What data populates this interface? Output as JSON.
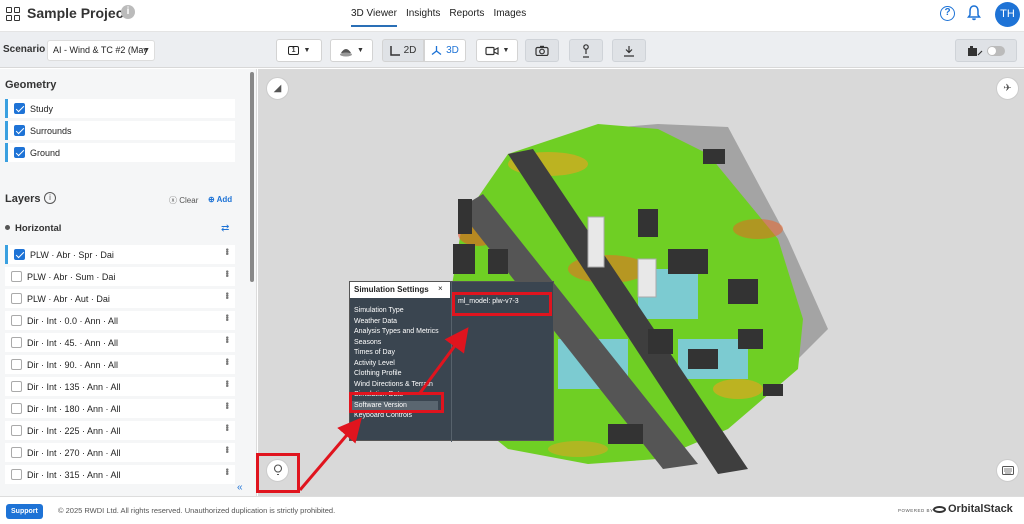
{
  "app": {
    "project_title": "Sample Project",
    "nav_tabs": [
      {
        "label": "3D Viewer",
        "active": true
      },
      {
        "label": "Insights",
        "active": false
      },
      {
        "label": "Reports",
        "active": false
      },
      {
        "label": "Images",
        "active": false
      }
    ],
    "user_initials": "TH",
    "accent_color": "#1e73d6"
  },
  "toolbar": {
    "scenario_label": "Scenario",
    "scenario_value": "AI - Wind & TC #2 (May",
    "frame_number": "1",
    "view_2d": "2D",
    "view_3d": "3D",
    "active_view": "3D"
  },
  "sidebar": {
    "geometry_title": "Geometry",
    "geometry_items": [
      {
        "label": "Study",
        "checked": true
      },
      {
        "label": "Surrounds",
        "checked": true
      },
      {
        "label": "Ground",
        "checked": true
      }
    ],
    "layers_title": "Layers",
    "clear_label": "Clear",
    "add_label": "Add",
    "horizontal_title": "Horizontal",
    "layers": [
      {
        "label": "PLW · Abr · Spr · Dai",
        "checked": true
      },
      {
        "label": "PLW · Abr · Sum · Dai",
        "checked": false
      },
      {
        "label": "PLW · Abr · Aut · Dai",
        "checked": false
      },
      {
        "label": "Dir · Int · 0.0 · Ann · All",
        "checked": false
      },
      {
        "label": "Dir · Int · 45. · Ann · All",
        "checked": false
      },
      {
        "label": "Dir · Int · 90. · Ann · All",
        "checked": false
      },
      {
        "label": "Dir · Int · 135 · Ann · All",
        "checked": false
      },
      {
        "label": "Dir · Int · 180 · Ann · All",
        "checked": false
      },
      {
        "label": "Dir · Int · 225 · Ann · All",
        "checked": false
      },
      {
        "label": "Dir · Int · 270 · Ann · All",
        "checked": false
      },
      {
        "label": "Dir · Int · 315 · Ann · All",
        "checked": false
      }
    ]
  },
  "simulation_settings": {
    "title": "Simulation Settings",
    "close_label": "×",
    "items": [
      "Simulation Type",
      "Weather Data",
      "Analysis Types and Metrics",
      "Seasons",
      "Times of Day",
      "Activity Level",
      "Clothing Profile",
      "Wind Directions & Terrain",
      "Simulation Date",
      "Software Version",
      "Keyboard Controls"
    ],
    "selected_item": "Software Version",
    "value": "ml_model: plw-v7-3"
  },
  "footer": {
    "support_label": "Support",
    "copyright": "© 2025 RWDI Ltd. All rights reserved. Unauthorized duplication is strictly prohibited.",
    "powered_by": "POWERED BY",
    "brand": "OrbitalStack"
  },
  "icons": {
    "grid": "grid-icon",
    "help": "help-icon",
    "bell": "bell-icon",
    "compass": "compass-icon",
    "rocket": "rocket-icon",
    "lightbulb": "lightbulb-icon",
    "keyboard": "keyboard-icon",
    "camera": "camera-icon",
    "video": "video-camera-icon",
    "person": "person-icon",
    "download": "download-icon"
  }
}
